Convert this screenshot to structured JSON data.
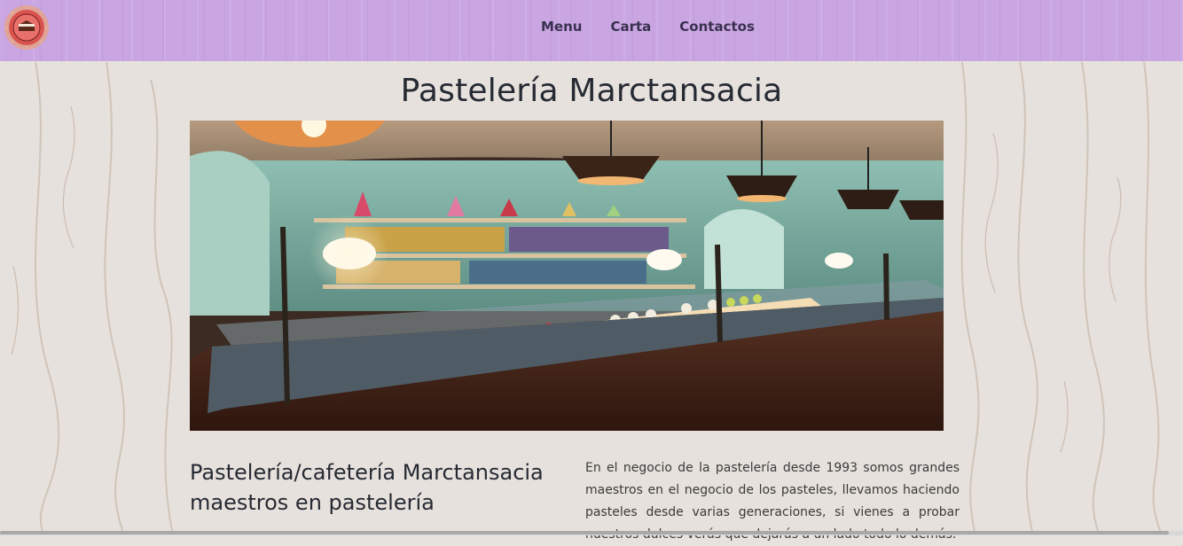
{
  "nav": {
    "logo": "cake-logo",
    "links": [
      {
        "label": "Menu"
      },
      {
        "label": "Carta"
      },
      {
        "label": "Contactos"
      }
    ]
  },
  "page": {
    "title": "Pastelería Marctansacia",
    "hero_image": "pastry-shop-interior",
    "subheading": "Pastelería/cafetería Marctansacia maestros en pastelería",
    "paragraph": "En el negocio de la pastelería desde 1993 somos grandes maestros en el negocio de los pasteles, llevamos haciendo pasteles desde varias generaciones, si vienes a probar nuestros dulces verás que dejarás a un lado todo lo demás."
  },
  "colors": {
    "topbar": "#c9a6e2",
    "nav_text": "#3a3050",
    "background": "#e7e2dd",
    "logo_ring": "#e05a5a"
  }
}
